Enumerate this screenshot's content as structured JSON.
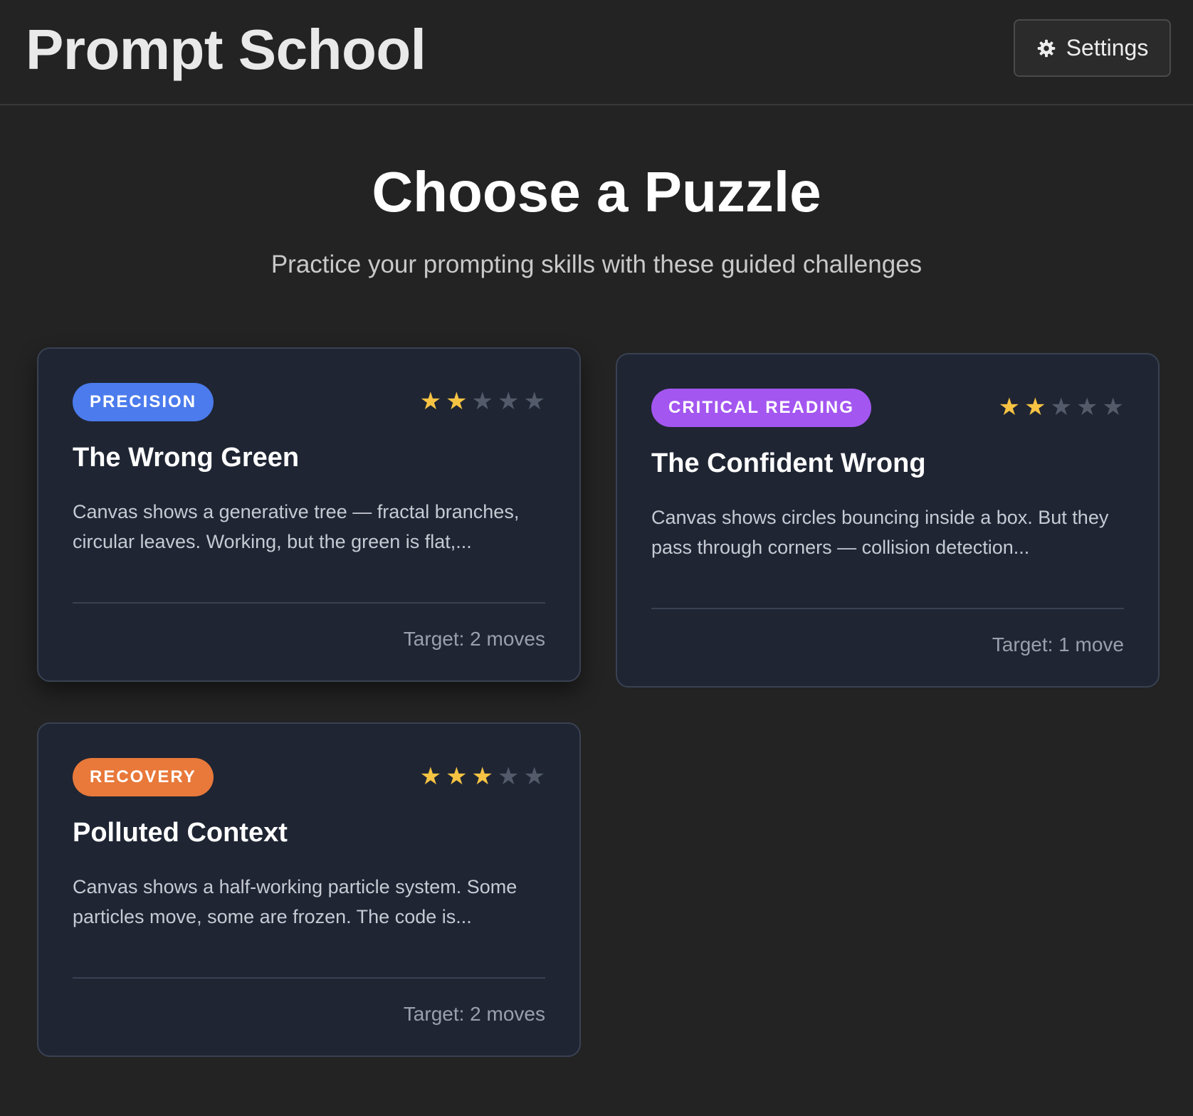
{
  "header": {
    "app_title": "Prompt School",
    "settings_label": "Settings"
  },
  "main": {
    "heading": "Choose a Puzzle",
    "subheading": "Practice your prompting skills with these guided challenges"
  },
  "puzzles": [
    {
      "category": "PRECISION",
      "category_color": "#4b7bec",
      "difficulty": 2,
      "difficulty_max": 5,
      "title": "The Wrong Green",
      "description": "Canvas shows a generative tree — fractal branches, circular leaves. Working, but the green is flat,...",
      "target": "Target: 2 moves"
    },
    {
      "category": "CRITICAL READING",
      "category_color": "#a356f0",
      "difficulty": 2,
      "difficulty_max": 5,
      "title": "The Confident Wrong",
      "description": "Canvas shows circles bouncing inside a box. But they pass through corners — collision detection...",
      "target": "Target: 1 move"
    },
    {
      "category": "RECOVERY",
      "category_color": "#e8793a",
      "difficulty": 3,
      "difficulty_max": 5,
      "title": "Polluted Context",
      "description": "Canvas shows a half-working particle system. Some particles move, some are frozen. The code is...",
      "target": "Target: 2 moves"
    }
  ],
  "colors": {
    "background": "#232323",
    "card_background": "#1f2533",
    "star_filled": "#f6c343",
    "star_empty": "#535b6a"
  },
  "icons": {
    "settings": "gear-icon",
    "rating": "star-icon"
  }
}
